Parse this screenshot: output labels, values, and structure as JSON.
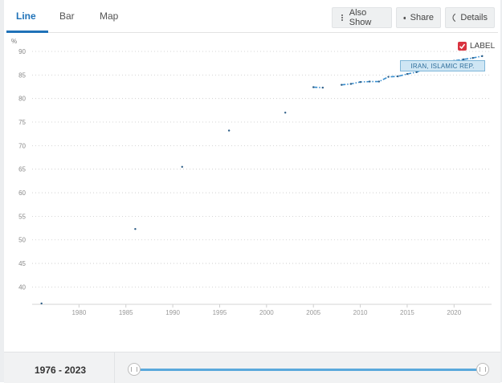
{
  "tabs": [
    {
      "label": "Line",
      "active": true
    },
    {
      "label": "Bar",
      "active": false
    },
    {
      "label": "Map",
      "active": false
    }
  ],
  "toolbar": {
    "also_show": {
      "label": "Also Show",
      "icon": "vertical-dots-icon"
    },
    "share": {
      "label": "Share",
      "icon": "share-icon"
    },
    "details": {
      "label": "Details",
      "icon": "info-circle-icon"
    }
  },
  "label_toggle": {
    "label": "LABEL",
    "checked": true,
    "color": "#d9333f"
  },
  "series_tag": "IRAN, ISLAMIC REP.",
  "footer": {
    "range_text": "1976 - 2023",
    "slider_start": 1976,
    "slider_end": 2023
  },
  "colors": {
    "accent": "#1f72b8",
    "series": "#3a8fcf",
    "point": "#2c5d86"
  },
  "chart_data": {
    "type": "line",
    "y_unit": "%",
    "xlim": [
      1975,
      2024
    ],
    "ylim": [
      37,
      90
    ],
    "y_ticks": [
      40,
      45,
      50,
      55,
      60,
      65,
      70,
      75,
      80,
      85,
      90
    ],
    "x_ticks": [
      1980,
      1985,
      1990,
      1995,
      2000,
      2005,
      2010,
      2015,
      2020
    ],
    "grid": true,
    "series": [
      {
        "name": "IRAN, ISLAMIC REP.",
        "points": [
          [
            1976,
            36.5
          ],
          [
            1986,
            52.3
          ],
          [
            1991,
            65.5
          ],
          [
            1996,
            73.2
          ],
          [
            2002,
            77.0
          ],
          [
            2005,
            82.4
          ],
          [
            2006,
            82.3
          ],
          [
            2008,
            82.9
          ],
          [
            2009,
            83.1
          ],
          [
            2010,
            83.5
          ],
          [
            2011,
            83.6
          ],
          [
            2012,
            83.6
          ],
          [
            2013,
            84.6
          ],
          [
            2014,
            84.7
          ],
          [
            2015,
            85.2
          ],
          [
            2016,
            85.6
          ],
          [
            2017,
            86.3
          ],
          [
            2018,
            87.0
          ],
          [
            2019,
            87.6
          ],
          [
            2020,
            88.0
          ],
          [
            2021,
            88.3
          ],
          [
            2022,
            88.6
          ],
          [
            2023,
            89.0
          ]
        ]
      }
    ]
  }
}
